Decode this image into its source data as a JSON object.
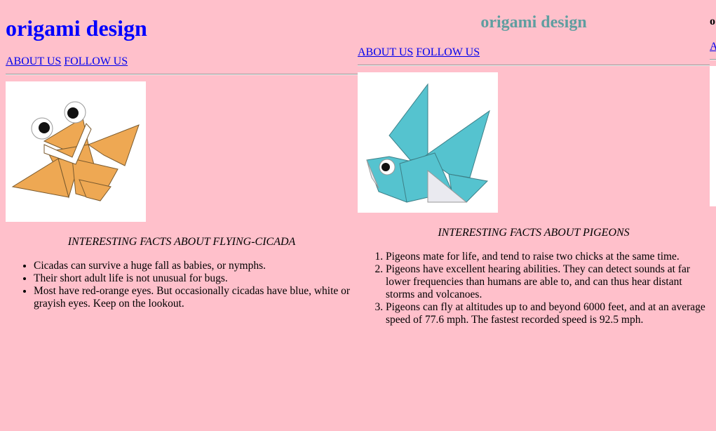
{
  "col1": {
    "title": "origami design",
    "nav": {
      "about": "ABOUT US",
      "follow": "FOLLOW US"
    },
    "image": "origami-cicada",
    "caption": "INTERESTING FACTS ABOUT FLYING-CICADA",
    "facts": [
      "Cicadas can survive a huge fall as babies, or nymphs.",
      "Their short adult life is not unusual for bugs.",
      "Most have red-orange eyes. But occasionally cicadas have blue, white or grayish eyes. Keep on the lookout."
    ]
  },
  "col2": {
    "title": "origami design",
    "nav": {
      "about": "ABOUT US",
      "follow": "FOLLOW US"
    },
    "image": "origami-pigeon",
    "caption": "INTERESTING FACTS ABOUT PIGEONS",
    "facts": [
      "Pigeons mate for life, and tend to raise two chicks at the same time.",
      "Pigeons have excellent hearing abilities. They can detect sounds at far lower frequencies than humans are able to, and can thus hear distant storms and volcanoes.",
      "Pigeons can fly at altitudes up to and beyond 6000 feet, and at an average speed of 77.6 mph. The fastest recorded speed is 92.5 mph."
    ]
  },
  "col3": {
    "title": "o",
    "nav": {
      "about": "A"
    }
  },
  "colors": {
    "background": "#ffc0cb",
    "title1": "#0000ff",
    "title2": "#5f9ea0",
    "link": "#0000ee",
    "cicada": "#eea853",
    "pigeon": "#55c3cf"
  }
}
